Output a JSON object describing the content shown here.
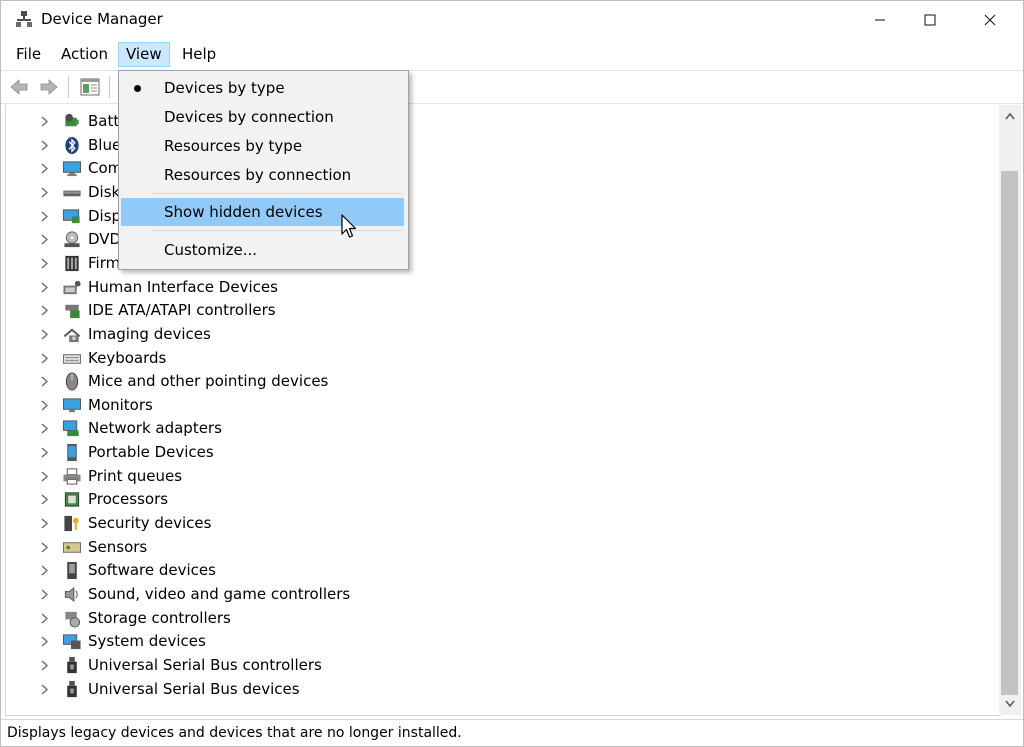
{
  "window": {
    "title": "Device Manager",
    "controls": {
      "minimize": "—",
      "maximize": "☐",
      "close": "✕"
    }
  },
  "menubar": {
    "file": "File",
    "action": "Action",
    "view": "View",
    "help": "Help"
  },
  "view_menu": {
    "items": [
      {
        "label": "Devices by type",
        "checked": true
      },
      {
        "label": "Devices by connection"
      },
      {
        "label": "Resources by type"
      },
      {
        "label": "Resources by connection"
      },
      {
        "label": "Show hidden devices",
        "highlighted": true
      },
      {
        "label": "Customize..."
      }
    ]
  },
  "tree": {
    "items": [
      {
        "label": "Batte",
        "icon": "battery-icon"
      },
      {
        "label": "Blue",
        "icon": "bluetooth-icon"
      },
      {
        "label": "Com",
        "icon": "computer-icon"
      },
      {
        "label": "Disk",
        "icon": "disk-icon"
      },
      {
        "label": "Disp",
        "icon": "display-icon"
      },
      {
        "label": "DVD",
        "icon": "dvd-icon"
      },
      {
        "label": "Firmware",
        "icon": "firmware-icon"
      },
      {
        "label": "Human Interface Devices",
        "icon": "hid-icon"
      },
      {
        "label": "IDE ATA/ATAPI controllers",
        "icon": "ide-icon"
      },
      {
        "label": "Imaging devices",
        "icon": "camera-icon"
      },
      {
        "label": "Keyboards",
        "icon": "keyboard-icon"
      },
      {
        "label": "Mice and other pointing devices",
        "icon": "mouse-icon"
      },
      {
        "label": "Monitors",
        "icon": "monitor-icon"
      },
      {
        "label": "Network adapters",
        "icon": "network-icon"
      },
      {
        "label": "Portable Devices",
        "icon": "portable-icon"
      },
      {
        "label": "Print queues",
        "icon": "printer-icon"
      },
      {
        "label": "Processors",
        "icon": "processor-icon"
      },
      {
        "label": "Security devices",
        "icon": "security-icon"
      },
      {
        "label": "Sensors",
        "icon": "sensor-icon"
      },
      {
        "label": "Software devices",
        "icon": "software-icon"
      },
      {
        "label": "Sound, video and game controllers",
        "icon": "sound-icon"
      },
      {
        "label": "Storage controllers",
        "icon": "storage-icon"
      },
      {
        "label": "System devices",
        "icon": "system-icon"
      },
      {
        "label": "Universal Serial Bus controllers",
        "icon": "usb-icon"
      },
      {
        "label": "Universal Serial Bus devices",
        "icon": "usb-icon"
      }
    ]
  },
  "statusbar": {
    "text": "Displays legacy devices and devices that are no longer installed."
  }
}
